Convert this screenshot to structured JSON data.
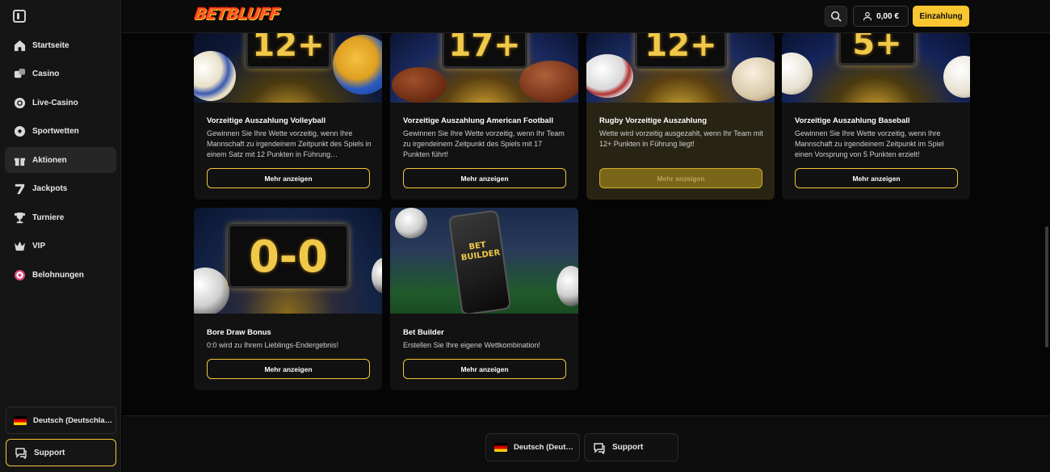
{
  "brand": {
    "logo_text": "BETBLUFF",
    "accent": "#f8c630",
    "logo_color": "#ff5a1f"
  },
  "sidebar": {
    "items": [
      {
        "label": "Startseite",
        "icon": "home-icon"
      },
      {
        "label": "Casino",
        "icon": "dice-icon"
      },
      {
        "label": "Live-Casino",
        "icon": "chip-icon"
      },
      {
        "label": "Sportwetten",
        "icon": "soccer-ball-icon"
      },
      {
        "label": "Aktionen",
        "icon": "gift-icon",
        "active": true
      },
      {
        "label": "Jackpots",
        "icon": "seven-icon"
      },
      {
        "label": "Turniere",
        "icon": "trophy-icon"
      },
      {
        "label": "VIP",
        "icon": "crown-icon"
      },
      {
        "label": "Belohnungen",
        "icon": "target-icon"
      }
    ],
    "language": "Deutsch (Deutschla…",
    "support": "Support"
  },
  "header": {
    "balance": "0,00 €",
    "deposit": "Einzahlung"
  },
  "promotions": [
    {
      "title": "Vorzeitige Auszahlung Volleyball",
      "description": "Gewinnen Sie Ihre Wette vorzeitig, wenn Ihre Mannschaft zu irgendeinem Zeitpunkt des Spiels in einem Satz mit 12 Punkten in Führung…",
      "button": "Mehr anzeigen",
      "score": "12+"
    },
    {
      "title": "Vorzeitige Auszahlung American Football",
      "description": "Gewinnen Sie Ihre Wette vorzeitig, wenn Ihr Team zu irgendeinem Zeitpunkt des Spiels mit 17 Punkten führt!",
      "button": "Mehr anzeigen",
      "score": "17+"
    },
    {
      "title": "Rugby Vorzeitige Auszahlung",
      "description": "Wette wird vorzeitig ausgezahlt, wenn Ihr Team mit 12+ Punkten in Führung liegt!",
      "button": "Mehr anzeigen",
      "score": "12+"
    },
    {
      "title": "Vorzeitige Auszahlung Baseball",
      "description": "Gewinnen Sie Ihre Wette vorzeitig, wenn Ihre Mannschaft zu irgendeinem Zeitpunkt im Spiel einen Vorsprung von 5 Punkten erzielt!",
      "button": "Mehr anzeigen",
      "score": "5+"
    },
    {
      "title": "Bore Draw Bonus",
      "description": "0:0 wird zu Ihrem Lieblings-Endergebnis!",
      "button": "Mehr anzeigen",
      "score": "0-0"
    },
    {
      "title": "Bet Builder",
      "description": "Erstellen Sie Ihre eigene Wettkombination!",
      "button": "Mehr anzeigen",
      "phone_text": "BET BUILDER"
    }
  ],
  "footer": {
    "language": "Deutsch (Deut…",
    "support": "Support"
  }
}
